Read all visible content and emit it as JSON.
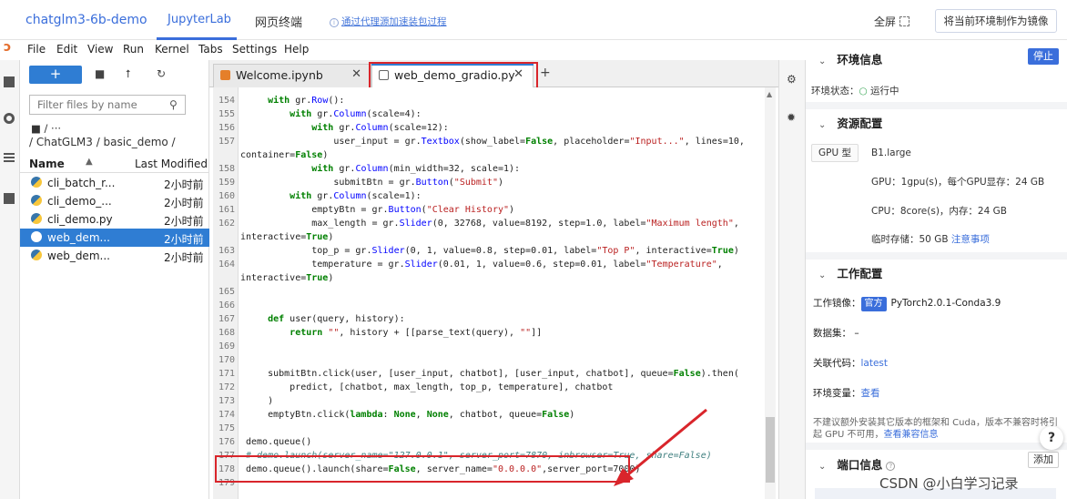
{
  "topbar": {
    "app_title": "chatglm3-6b-demo",
    "tab_jupyterlab": "JupyterLab",
    "tab_terminal": "网页终端",
    "proxy_link": "通过代理源加速装包过程",
    "fullscreen": "全屏",
    "mirror_button": "将当前环境制作为镜像"
  },
  "menu": [
    "File",
    "Edit",
    "View",
    "Run",
    "Kernel",
    "Tabs",
    "Settings",
    "Help"
  ],
  "filebrowser": {
    "new_label": "+",
    "filter_placeholder": "Filter files by name",
    "crumb_root": "/ ···",
    "crumb_path": "/ ChatGLM3 / basic_demo /",
    "col_name": "Name",
    "col_modified": "Last Modified",
    "files": [
      {
        "name": "cli_batch_r...",
        "modified": "2小时前"
      },
      {
        "name": "cli_demo_...",
        "modified": "2小时前"
      },
      {
        "name": "cli_demo.py",
        "modified": "2小时前"
      },
      {
        "name": "web_dem...",
        "modified": "2小时前"
      },
      {
        "name": "web_dem...",
        "modified": "2小时前"
      }
    ]
  },
  "editor": {
    "tabs": [
      {
        "label": "Welcome.ipynb"
      },
      {
        "label": "web_demo_gradio.py"
      }
    ],
    "close_glyph": "✕",
    "add_glyph": "+",
    "lines": [
      {
        "n": "154",
        "t": "    with gr.Row():"
      },
      {
        "n": "155",
        "t": "        with gr.Column(scale=4):"
      },
      {
        "n": "156",
        "t": "            with gr.Column(scale=12):"
      },
      {
        "n": "157",
        "t": "                user_input = gr.Textbox(show_label=False, placeholder=\"Input...\", lines=10,"
      },
      {
        "n": "",
        "t": "container=False)",
        "wrap": true
      },
      {
        "n": "158",
        "t": "            with gr.Column(min_width=32, scale=1):"
      },
      {
        "n": "159",
        "t": "                submitBtn = gr.Button(\"Submit\")"
      },
      {
        "n": "160",
        "t": "        with gr.Column(scale=1):"
      },
      {
        "n": "161",
        "t": "            emptyBtn = gr.Button(\"Clear History\")"
      },
      {
        "n": "162",
        "t": "            max_length = gr.Slider(0, 32768, value=8192, step=1.0, label=\"Maximum length\","
      },
      {
        "n": "",
        "t": "interactive=True)",
        "wrap": true
      },
      {
        "n": "163",
        "t": "            top_p = gr.Slider(0, 1, value=0.8, step=0.01, label=\"Top P\", interactive=True)"
      },
      {
        "n": "164",
        "t": "            temperature = gr.Slider(0.01, 1, value=0.6, step=0.01, label=\"Temperature\","
      },
      {
        "n": "",
        "t": "interactive=True)",
        "wrap": true
      },
      {
        "n": "165",
        "t": ""
      },
      {
        "n": "166",
        "t": ""
      },
      {
        "n": "167",
        "t": "    def user(query, history):"
      },
      {
        "n": "168",
        "t": "        return \"\", history + [[parse_text(query), \"\"]]"
      },
      {
        "n": "169",
        "t": ""
      },
      {
        "n": "170",
        "t": ""
      },
      {
        "n": "171",
        "t": "    submitBtn.click(user, [user_input, chatbot], [user_input, chatbot], queue=False).then("
      },
      {
        "n": "172",
        "t": "        predict, [chatbot, max_length, top_p, temperature], chatbot"
      },
      {
        "n": "173",
        "t": "    )"
      },
      {
        "n": "174",
        "t": "    emptyBtn.click(lambda: None, None, chatbot, queue=False)"
      },
      {
        "n": "175",
        "t": ""
      },
      {
        "n": "176",
        "t": "demo.queue()"
      },
      {
        "n": "177",
        "t": "# demo.launch(server_name=\"127.0.0.1\", server_port=7870, inbrowser=True, share=False)"
      },
      {
        "n": "178",
        "t": "demo.queue().launch(share=False, server_name=\"0.0.0.0\",server_port=7000)"
      },
      {
        "n": "179",
        "t": ""
      }
    ]
  },
  "rightpanel": {
    "env_title": "环境信息",
    "stop_button": "停止",
    "env_status_label": "环境状态：",
    "env_status_value": "运行中",
    "res_title": "资源配置",
    "gpu_type_label": "GPU 型",
    "gpu_type_value": "B1.large",
    "gpu_line": "GPU：1gpu(s)，每个GPU显存：24 GB",
    "cpu_line": "CPU：8core(s)，内存：24 GB",
    "storage_line": "临时存储：50 GB",
    "storage_link": "注意事项",
    "work_title": "工作配置",
    "image_label": "工作镜像：",
    "image_tag": "官方",
    "image_value": "PyTorch2.0.1-Conda3.9",
    "dataset_label": "数据集：",
    "dataset_value": "–",
    "code_label": "关联代码：",
    "code_value": "latest",
    "envvar_label": "环境变量：",
    "envvar_link": "查看",
    "warning_line1": "不建议额外安装其它版本的框架和 Cuda，版本不兼容时将引",
    "warning_line2": "起 GPU 不可用，",
    "warning_link": "查看兼容信息",
    "port_title": "端口信息",
    "add_button": "添加",
    "help": "?"
  },
  "watermark": "CSDN @小白学习记录"
}
